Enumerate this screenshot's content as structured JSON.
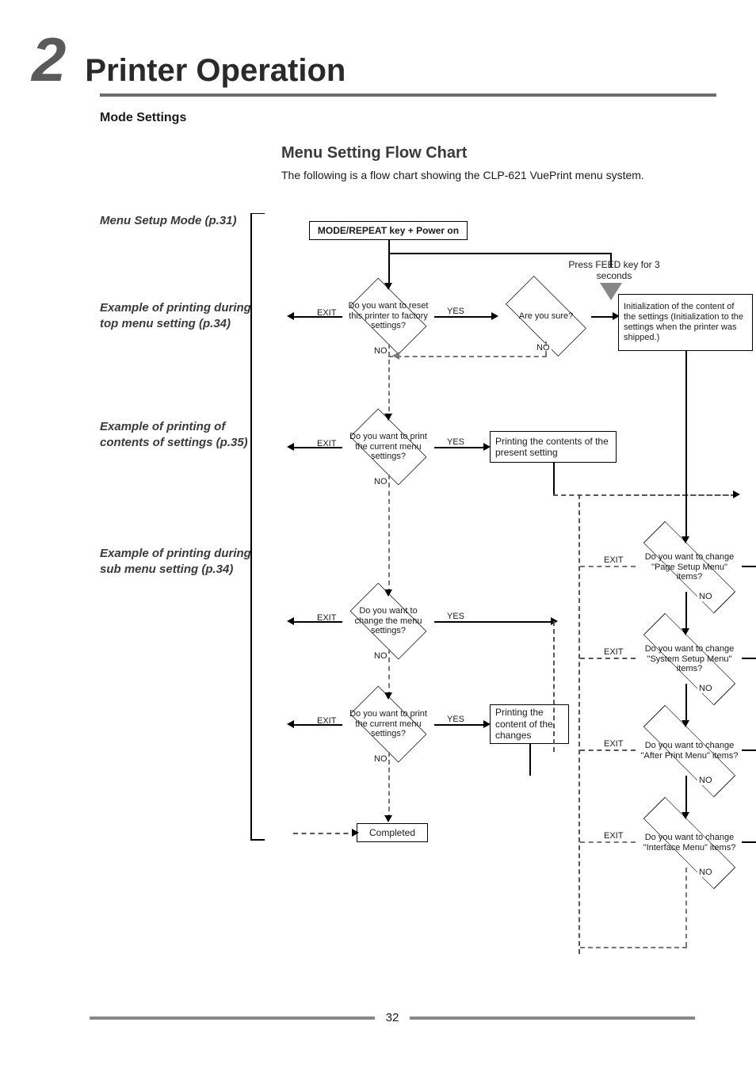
{
  "chapter_number": "2",
  "chapter_title": "Printer Operation",
  "subtitle": "Mode Settings",
  "section_title": "Menu Setting Flow Chart",
  "section_desc": "The following is a flow chart showing the CLP-621 VuePrint menu system.",
  "side_notes": {
    "n1": "Menu Setup Mode (p.31)",
    "n2": "Example of printing during top menu setting (p.34)",
    "n3": "Example of printing of contents of settings (p.35)",
    "n4": "Example of printing during sub menu setting (p.34)"
  },
  "nodes": {
    "start": "MODE/REPEAT key + Power on",
    "feed_note": "Press FEED key for 3 seconds",
    "d1": "Do you want to reset this printer to factory settings?",
    "d2": "Are you sure?",
    "init_box": "Initialization of the content of the settings (Initialization to the settings when the printer was shipped.)",
    "d3": "Do you want to print the current menu settings?",
    "p3": "Printing the contents of the present setting",
    "d4": "Do you want to change the menu settings?",
    "d5": "Do you want to print the current menu settings?",
    "p5": "Printing the content of the changes",
    "completed": "Completed",
    "s1": "Do you want to change \"Page Setup Menu\" items?",
    "s2": "Do you want to change \"System Setup Menu\" items?",
    "s3": "Do you want to change \"After Print Menu\" items?",
    "s4": "Do you want to change \"Interface Menu\" items?"
  },
  "labels": {
    "exit": "EXIT",
    "yes": "YES",
    "no": "NO"
  },
  "page_number": "32"
}
